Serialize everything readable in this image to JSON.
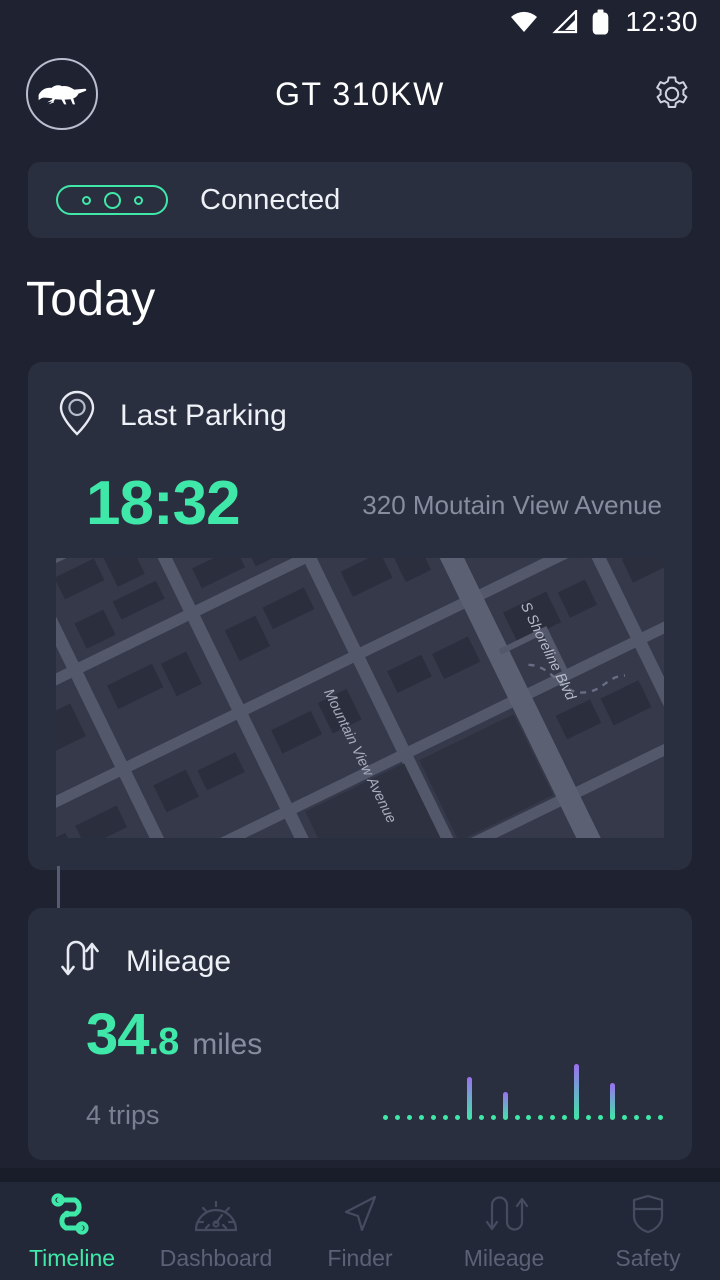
{
  "status_bar": {
    "time": "12:30",
    "icons": [
      "wifi-icon",
      "cellular-signal-icon",
      "battery-icon"
    ]
  },
  "app_bar": {
    "logo_icon": "mustang-pony-logo",
    "title": "GT 310KW",
    "settings_icon": "gear-icon"
  },
  "connection": {
    "icon": "obd-dongle-icon",
    "status_label": "Connected",
    "accent_color": "#3fe8a8"
  },
  "section": {
    "title": "Today"
  },
  "parking_card": {
    "icon": "map-pin-icon",
    "title": "Last Parking",
    "time": "18:32",
    "address": "320 Moutain View Avenue",
    "map": {
      "street_labels": [
        "Mountain View Avenue",
        "S Shoreline Blvd"
      ]
    }
  },
  "mileage_card": {
    "icon": "u-turn-arrows-icon",
    "title": "Mileage",
    "value_whole": "34",
    "value_decimal": ".8",
    "unit": "miles",
    "trips": "4 trips"
  },
  "chart_data": {
    "type": "bar",
    "title": "Mileage sparkline",
    "xlabel": "",
    "ylabel": "",
    "grid": false,
    "legend": false,
    "ylim": [
      0,
      10
    ],
    "categories": [
      "1",
      "2",
      "3",
      "4",
      "5",
      "6",
      "7",
      "8",
      "9",
      "10",
      "11",
      "12",
      "13",
      "14",
      "15",
      "16",
      "17",
      "18",
      "19",
      "20",
      "21",
      "22",
      "23",
      "24"
    ],
    "values": [
      0.5,
      0.5,
      0.5,
      0.5,
      0.5,
      0.5,
      0.5,
      7.0,
      0.5,
      0.5,
      4.5,
      0.5,
      0.5,
      0.5,
      0.5,
      0.5,
      9.0,
      0.5,
      0.5,
      6.0,
      0.5,
      0.5,
      0.5,
      0.5
    ],
    "bar_gradient": [
      "#9b6ff0",
      "#3fe8a8"
    ]
  },
  "bottom_nav": {
    "items": [
      {
        "label": "Timeline",
        "icon": "timeline-route-icon",
        "active": true
      },
      {
        "label": "Dashboard",
        "icon": "gauge-icon",
        "active": false
      },
      {
        "label": "Finder",
        "icon": "navigation-arrow-icon",
        "active": false
      },
      {
        "label": "Mileage",
        "icon": "u-turn-arrows-icon",
        "active": false
      },
      {
        "label": "Safety",
        "icon": "shield-icon",
        "active": false
      }
    ]
  },
  "colors": {
    "background": "#1e2231",
    "card": "#2a2f3f",
    "accent": "#3fe8a8",
    "muted_text": "#878d9e",
    "nav_bar": "#232838"
  }
}
